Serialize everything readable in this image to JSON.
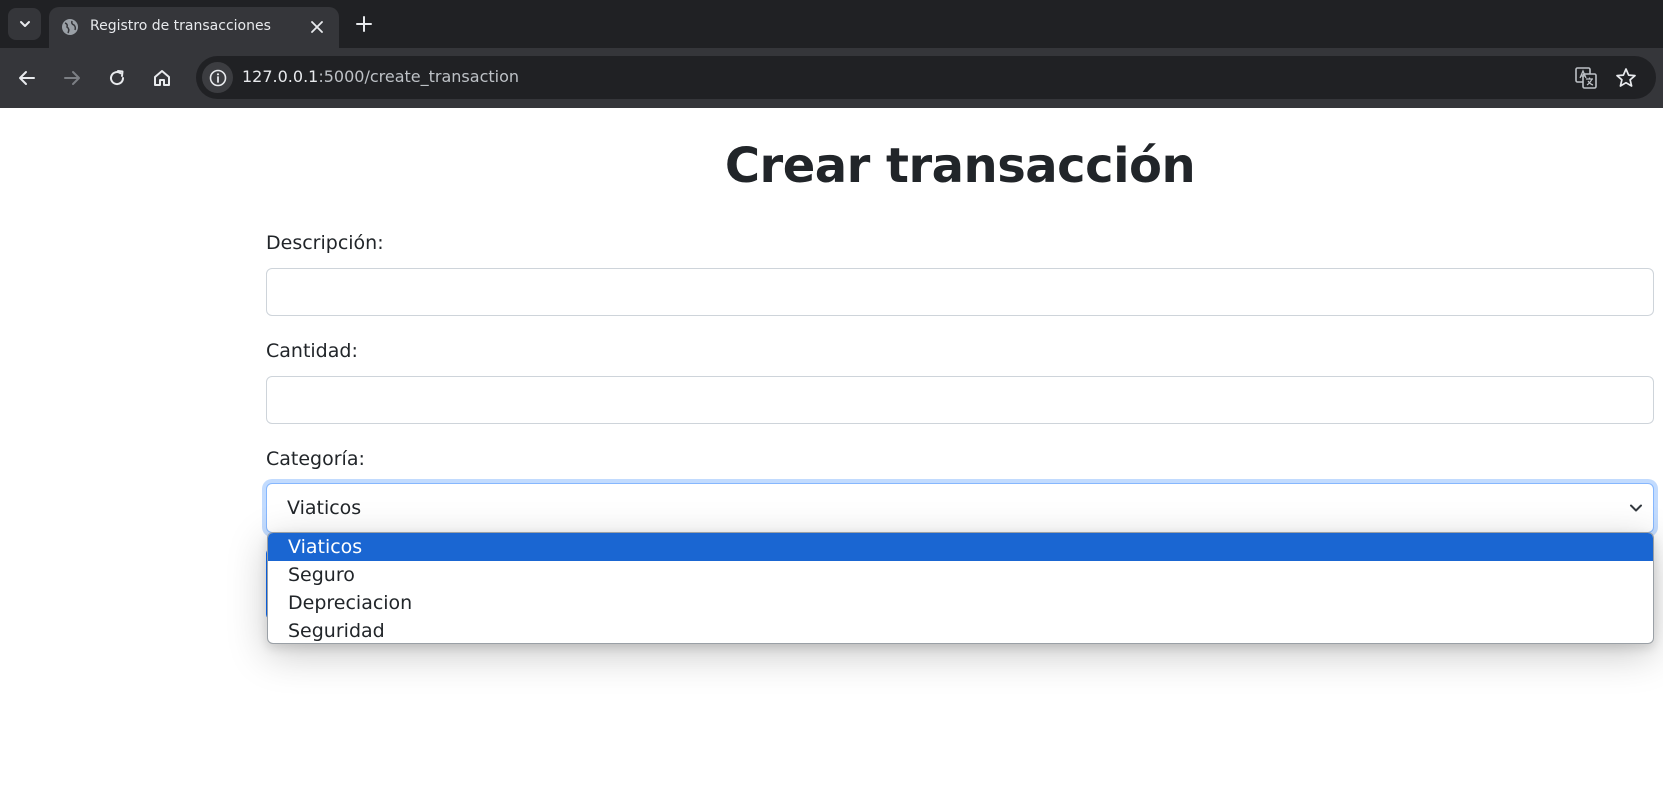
{
  "browser": {
    "tab": {
      "title": "Registro de transacciones"
    },
    "address": {
      "host": "127.0.0.1",
      "path": ":5000/create_transaction"
    }
  },
  "page": {
    "title": "Crear transacción",
    "form": {
      "description": {
        "label": "Descripción:",
        "value": ""
      },
      "amount": {
        "label": "Cantidad:",
        "value": ""
      },
      "category": {
        "label": "Categoría:",
        "selected": "Viaticos",
        "options": [
          "Viaticos",
          "Seguro",
          "Depreciacion",
          "Seguridad"
        ]
      }
    }
  },
  "colors": {
    "tabstrip": "#202124",
    "toolbar": "#35363a",
    "option_highlight": "#1a66d2",
    "focus_ring": "#86b7fe",
    "submit_button": "#0d6efd"
  },
  "icons": [
    "tab-search-icon",
    "globe-icon",
    "close-icon",
    "plus-icon",
    "back-icon",
    "forward-icon",
    "reload-icon",
    "home-icon",
    "info-icon",
    "translate-icon",
    "star-icon",
    "chevron-down-icon"
  ]
}
